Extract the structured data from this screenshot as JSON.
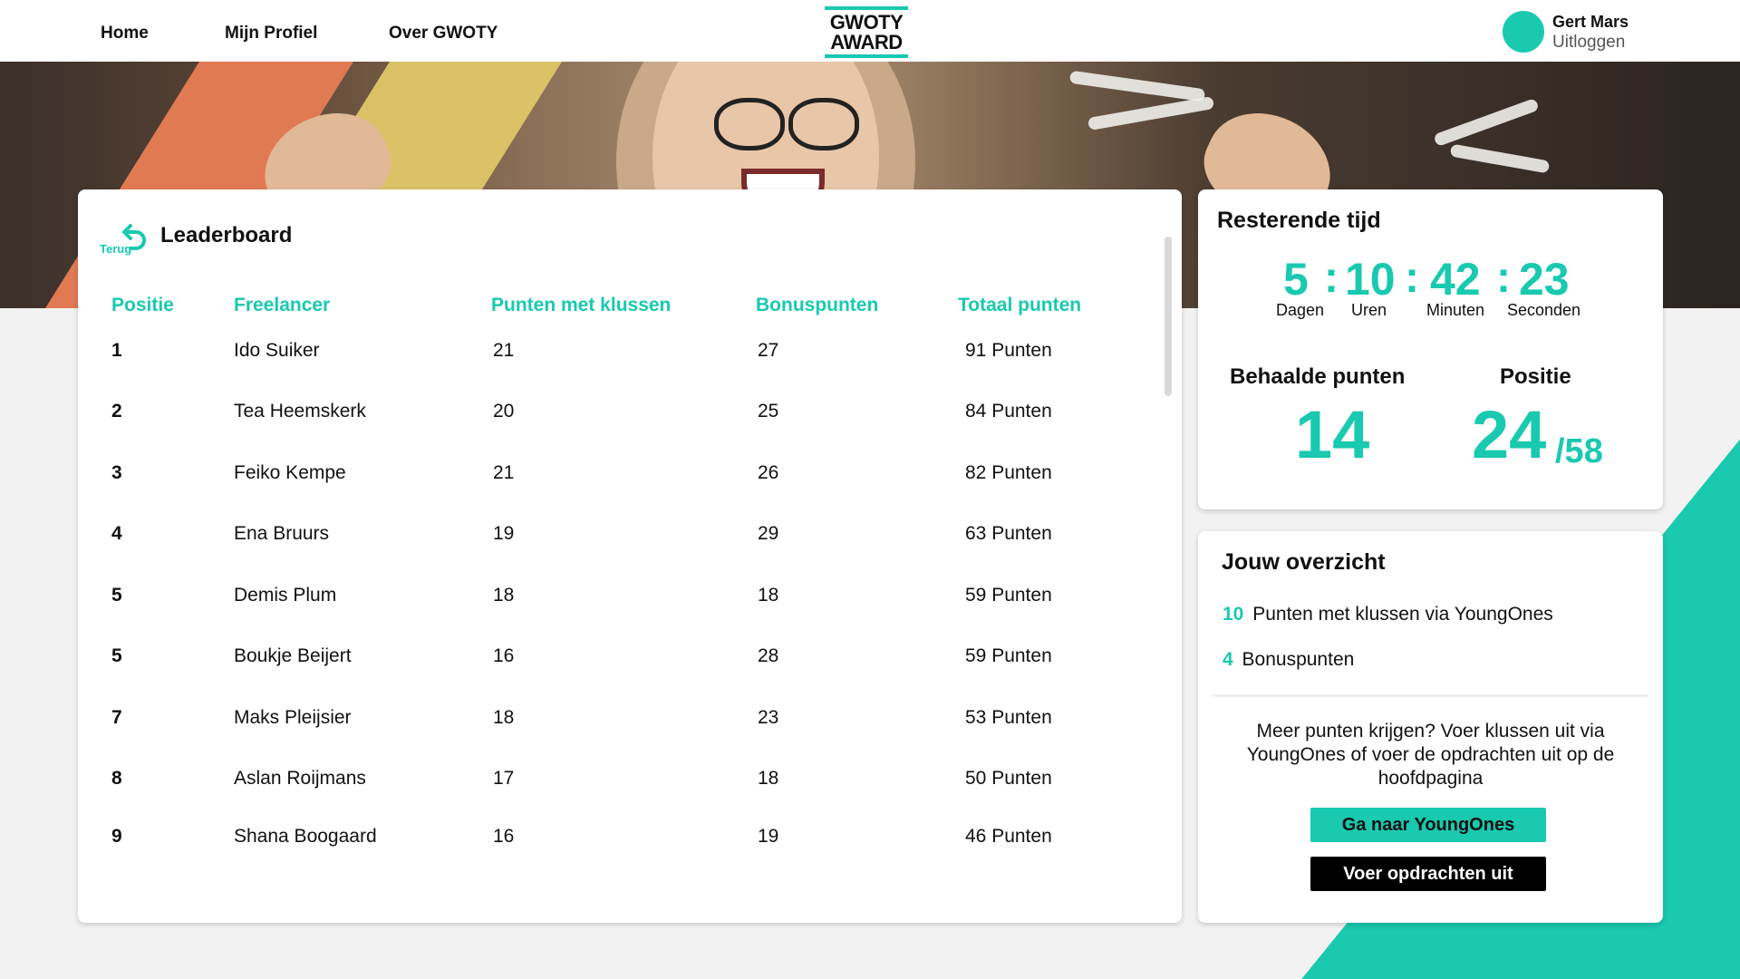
{
  "nav": {
    "links": [
      "Home",
      "Mijn Profiel",
      "Over GWOTY"
    ],
    "logo_line1": "GWOTY",
    "logo_line2": "AWARD",
    "user_name": "Gert Mars",
    "logout_label": "Uitloggen"
  },
  "colors": {
    "accent": "#19c9b0",
    "text": "#111111",
    "background": "#f2f2f2"
  },
  "leaderboard": {
    "back_label": "Terug",
    "title": "Leaderboard",
    "columns": [
      "Positie",
      "Freelancer",
      "Punten met klussen",
      "Bonuspunten",
      "Totaal punten"
    ],
    "rows": [
      {
        "pos": "1",
        "name": "Ido Suiker",
        "klussen": "21",
        "bonus": "27",
        "totaal": "91 Punten"
      },
      {
        "pos": "2",
        "name": "Tea Heemskerk",
        "klussen": "20",
        "bonus": "25",
        "totaal": "84 Punten"
      },
      {
        "pos": "3",
        "name": "Feiko Kempe",
        "klussen": "21",
        "bonus": "26",
        "totaal": "82 Punten"
      },
      {
        "pos": "4",
        "name": "Ena Bruurs",
        "klussen": "19",
        "bonus": "29",
        "totaal": "63 Punten"
      },
      {
        "pos": "5",
        "name": "Demis Plum",
        "klussen": "18",
        "bonus": "18",
        "totaal": "59 Punten"
      },
      {
        "pos": "5",
        "name": "Boukje Beijert",
        "klussen": "16",
        "bonus": "28",
        "totaal": "59 Punten"
      },
      {
        "pos": "7",
        "name": "Maks Pleijsier",
        "klussen": "18",
        "bonus": "23",
        "totaal": "53 Punten"
      },
      {
        "pos": "8",
        "name": "Aslan Roijmans",
        "klussen": "17",
        "bonus": "18",
        "totaal": "50 Punten"
      },
      {
        "pos": "9",
        "name": "Shana Boogaard",
        "klussen": "16",
        "bonus": "19",
        "totaal": "46 Punten"
      }
    ]
  },
  "countdown": {
    "title": "Resterende tijd",
    "days": "5",
    "hours": "10",
    "minutes": "42",
    "seconds": "23",
    "days_label": "Dagen",
    "hours_label": "Uren",
    "minutes_label": "Minuten",
    "seconds_label": "Seconden"
  },
  "score": {
    "points_label": "Behaalde punten",
    "points": "14",
    "position_label": "Positie",
    "position": "24",
    "position_total": "/58"
  },
  "overview": {
    "title": "Jouw overzicht",
    "line1_num": "10",
    "line1_text": "Punten met klussen via YoungOnes",
    "line2_num": "4",
    "line2_text": "Bonuspunten",
    "info": "Meer punten krijgen? Voer klussen uit via YoungOnes of voer de opdrachten uit op de hoofdpagina",
    "button_youngones": "Ga naar YoungOnes",
    "button_opdrachten": "Voer opdrachten uit"
  }
}
